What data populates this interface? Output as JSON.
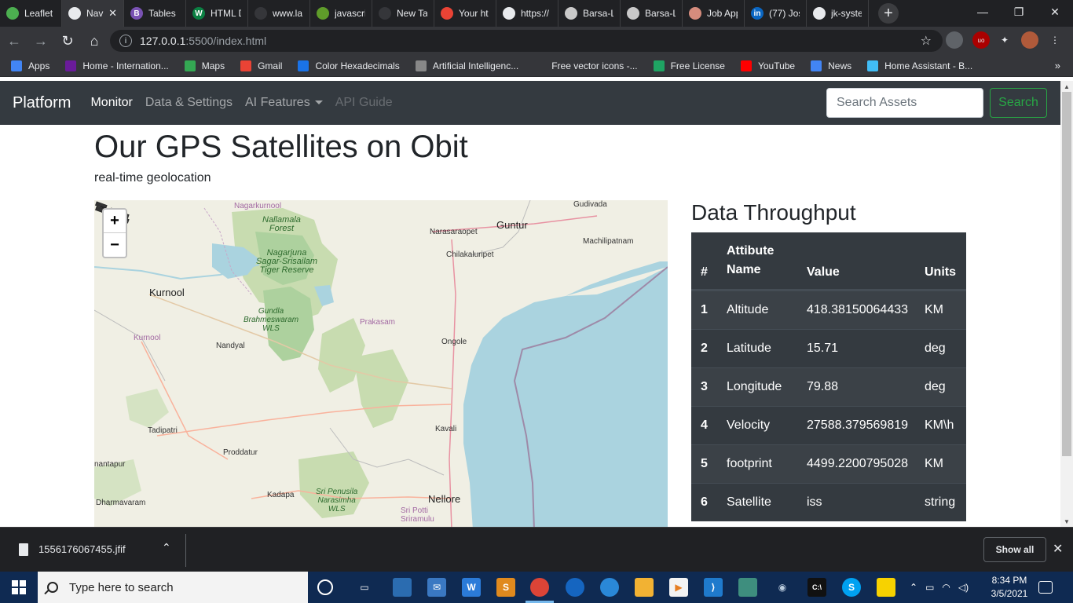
{
  "browser": {
    "tabs": [
      {
        "label": "Leaflet",
        "color": "#4caf50",
        "glyph": ""
      },
      {
        "label": "Nav",
        "color": "#e8eaed",
        "glyph": "",
        "active": true
      },
      {
        "label": "Tables",
        "color": "#7952b3",
        "glyph": "B"
      },
      {
        "label": "HTML D",
        "color": "#0b8043",
        "glyph": "W"
      },
      {
        "label": "www.la",
        "color": "#35363a",
        "glyph": ""
      },
      {
        "label": "javascri",
        "color": "#5f9c2a",
        "glyph": ""
      },
      {
        "label": "New Tab",
        "color": "#35363a",
        "glyph": ""
      },
      {
        "label": "Your ht",
        "color": "#ea4335",
        "glyph": ""
      },
      {
        "label": "https://",
        "color": "#e8eaed",
        "glyph": ""
      },
      {
        "label": "Barsa-L",
        "color": "#c9c9c9",
        "glyph": ""
      },
      {
        "label": "Barsa-L",
        "color": "#c9c9c9",
        "glyph": ""
      },
      {
        "label": "Job App",
        "color": "#d58c7d",
        "glyph": ""
      },
      {
        "label": "(77) Jos",
        "color": "#0a66c2",
        "glyph": "in"
      },
      {
        "label": "jk-syste",
        "color": "#e8eaed",
        "glyph": ""
      }
    ],
    "new_tab_label": "+",
    "window_controls": {
      "minimize": "—",
      "restore": "❐",
      "close": "✕"
    },
    "url_host": "127.0.0.1",
    "url_path": ":5500/index.html",
    "bookmarks": [
      {
        "label": "Apps",
        "color": "#4285f4"
      },
      {
        "label": "Home - Internation...",
        "color": "#6a1b9a"
      },
      {
        "label": "Maps",
        "color": "#34a853"
      },
      {
        "label": "Gmail",
        "color": "#ea4335"
      },
      {
        "label": "Color Hexadecimals",
        "color": "#1a73e8"
      },
      {
        "label": "Artificial Intelligenc...",
        "color": "#888888"
      },
      {
        "label": "Free vector icons -...",
        "color": "#35363a"
      },
      {
        "label": "Free License",
        "color": "#1fa463"
      },
      {
        "label": "YouTube",
        "color": "#ff0000"
      },
      {
        "label": "News",
        "color": "#4285f4"
      },
      {
        "label": "Home Assistant - B...",
        "color": "#41bdf5"
      }
    ],
    "bookmarks_more": "»"
  },
  "navbar": {
    "brand": "Platform",
    "links": {
      "monitor": "Monitor",
      "data_settings": "Data & Settings",
      "ai_features": "AI Features",
      "api_guide": "API Guide"
    },
    "search_placeholder": "Search Assets",
    "search_button": "Search"
  },
  "page": {
    "title": "Our GPS Satellites on Obit",
    "subtitle": "real-time geolocation"
  },
  "map": {
    "zoom_in": "+",
    "zoom_out": "−",
    "labels": {
      "nagarkurnool": "Nagarkurnool",
      "nallamala": "Nallamala\nForest",
      "nagarjuna": "Nagarjuna\nSagar-Srisailam\nTiger Reserve",
      "kurnool": "Kurnool",
      "kurnool_small": "Kurnool",
      "gundla": "Gundla\nBrahmeswaram\nWLS",
      "nandyal": "Nandyal",
      "prakasam": "Prakasam",
      "ongole": "Ongole",
      "vudavada": "Gudivada",
      "narasaraopet": "Narasaraopet",
      "guntur": "Guntur",
      "machilipatnam": "Machilipatnam",
      "chilakaluripet": "Chilakaluripet",
      "tadipatri": "Tadipatri",
      "proddatur": "Proddatur",
      "anantapur": "nantapur",
      "kavali": "Kavali",
      "dharmavaram": "Dharmavaram",
      "kadapa": "Kadapa",
      "penusila": "Sri Penusila\nNarasimha\nWLS",
      "nellore": "Nellore",
      "sri_potti": "Sri Potti\nSriramulu"
    }
  },
  "throughput": {
    "heading": "Data Throughput",
    "columns": [
      "#",
      "Attibute Name",
      "Value",
      "Units"
    ],
    "rows": [
      {
        "num": "1",
        "name": "Altitude",
        "value": "418.38150064433",
        "units": "KM"
      },
      {
        "num": "2",
        "name": "Latitude",
        "value": "15.71",
        "units": "deg"
      },
      {
        "num": "3",
        "name": "Longitude",
        "value": "79.88",
        "units": "deg"
      },
      {
        "num": "4",
        "name": "Velocity",
        "value": "27588.379569819",
        "units": "KM\\h"
      },
      {
        "num": "5",
        "name": "footprint",
        "value": "4499.2200795028",
        "units": "KM"
      },
      {
        "num": "6",
        "name": "Satellite",
        "value": "iss",
        "units": "string"
      }
    ]
  },
  "downloads": {
    "file_name": "1556176067455.jfif",
    "show_all": "Show all"
  },
  "taskbar": {
    "search_placeholder": "Type here to search",
    "time": "8:34 PM",
    "date": "3/5/2021"
  }
}
